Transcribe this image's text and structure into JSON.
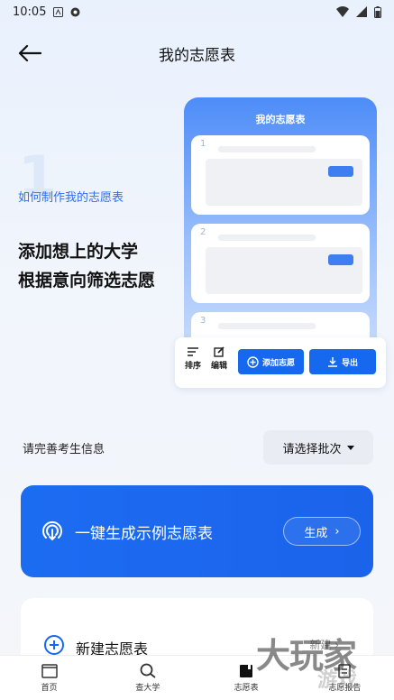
{
  "status_bar": {
    "time": "10:05"
  },
  "header": {
    "title": "我的志愿表"
  },
  "guide": {
    "step": "1",
    "subtitle": "如何制作我的志愿表",
    "line1": "添加想上的大学",
    "line2": "根据意向筛选志愿"
  },
  "mockup": {
    "title": "我的志愿表",
    "card_numbers": [
      "1",
      "2",
      "3"
    ],
    "toolbar": {
      "sort": "排序",
      "edit": "编辑",
      "add": "添加志愿",
      "export": "导出"
    }
  },
  "info": {
    "label": "请完善考生信息",
    "batch_placeholder": "请选择批次"
  },
  "generate": {
    "text": "一键生成示例志愿表",
    "button": "生成"
  },
  "new_table": {
    "label": "新建志愿表",
    "link": "新建"
  },
  "tabs": [
    {
      "label": "首页"
    },
    {
      "label": "查大学"
    },
    {
      "label": "志愿表"
    },
    {
      "label": "志愿报告"
    }
  ],
  "watermark": {
    "text": "大玩家",
    "sub": "游戏"
  },
  "colors": {
    "accent": "#1668ee",
    "card_blue": "#1c6cf2"
  }
}
